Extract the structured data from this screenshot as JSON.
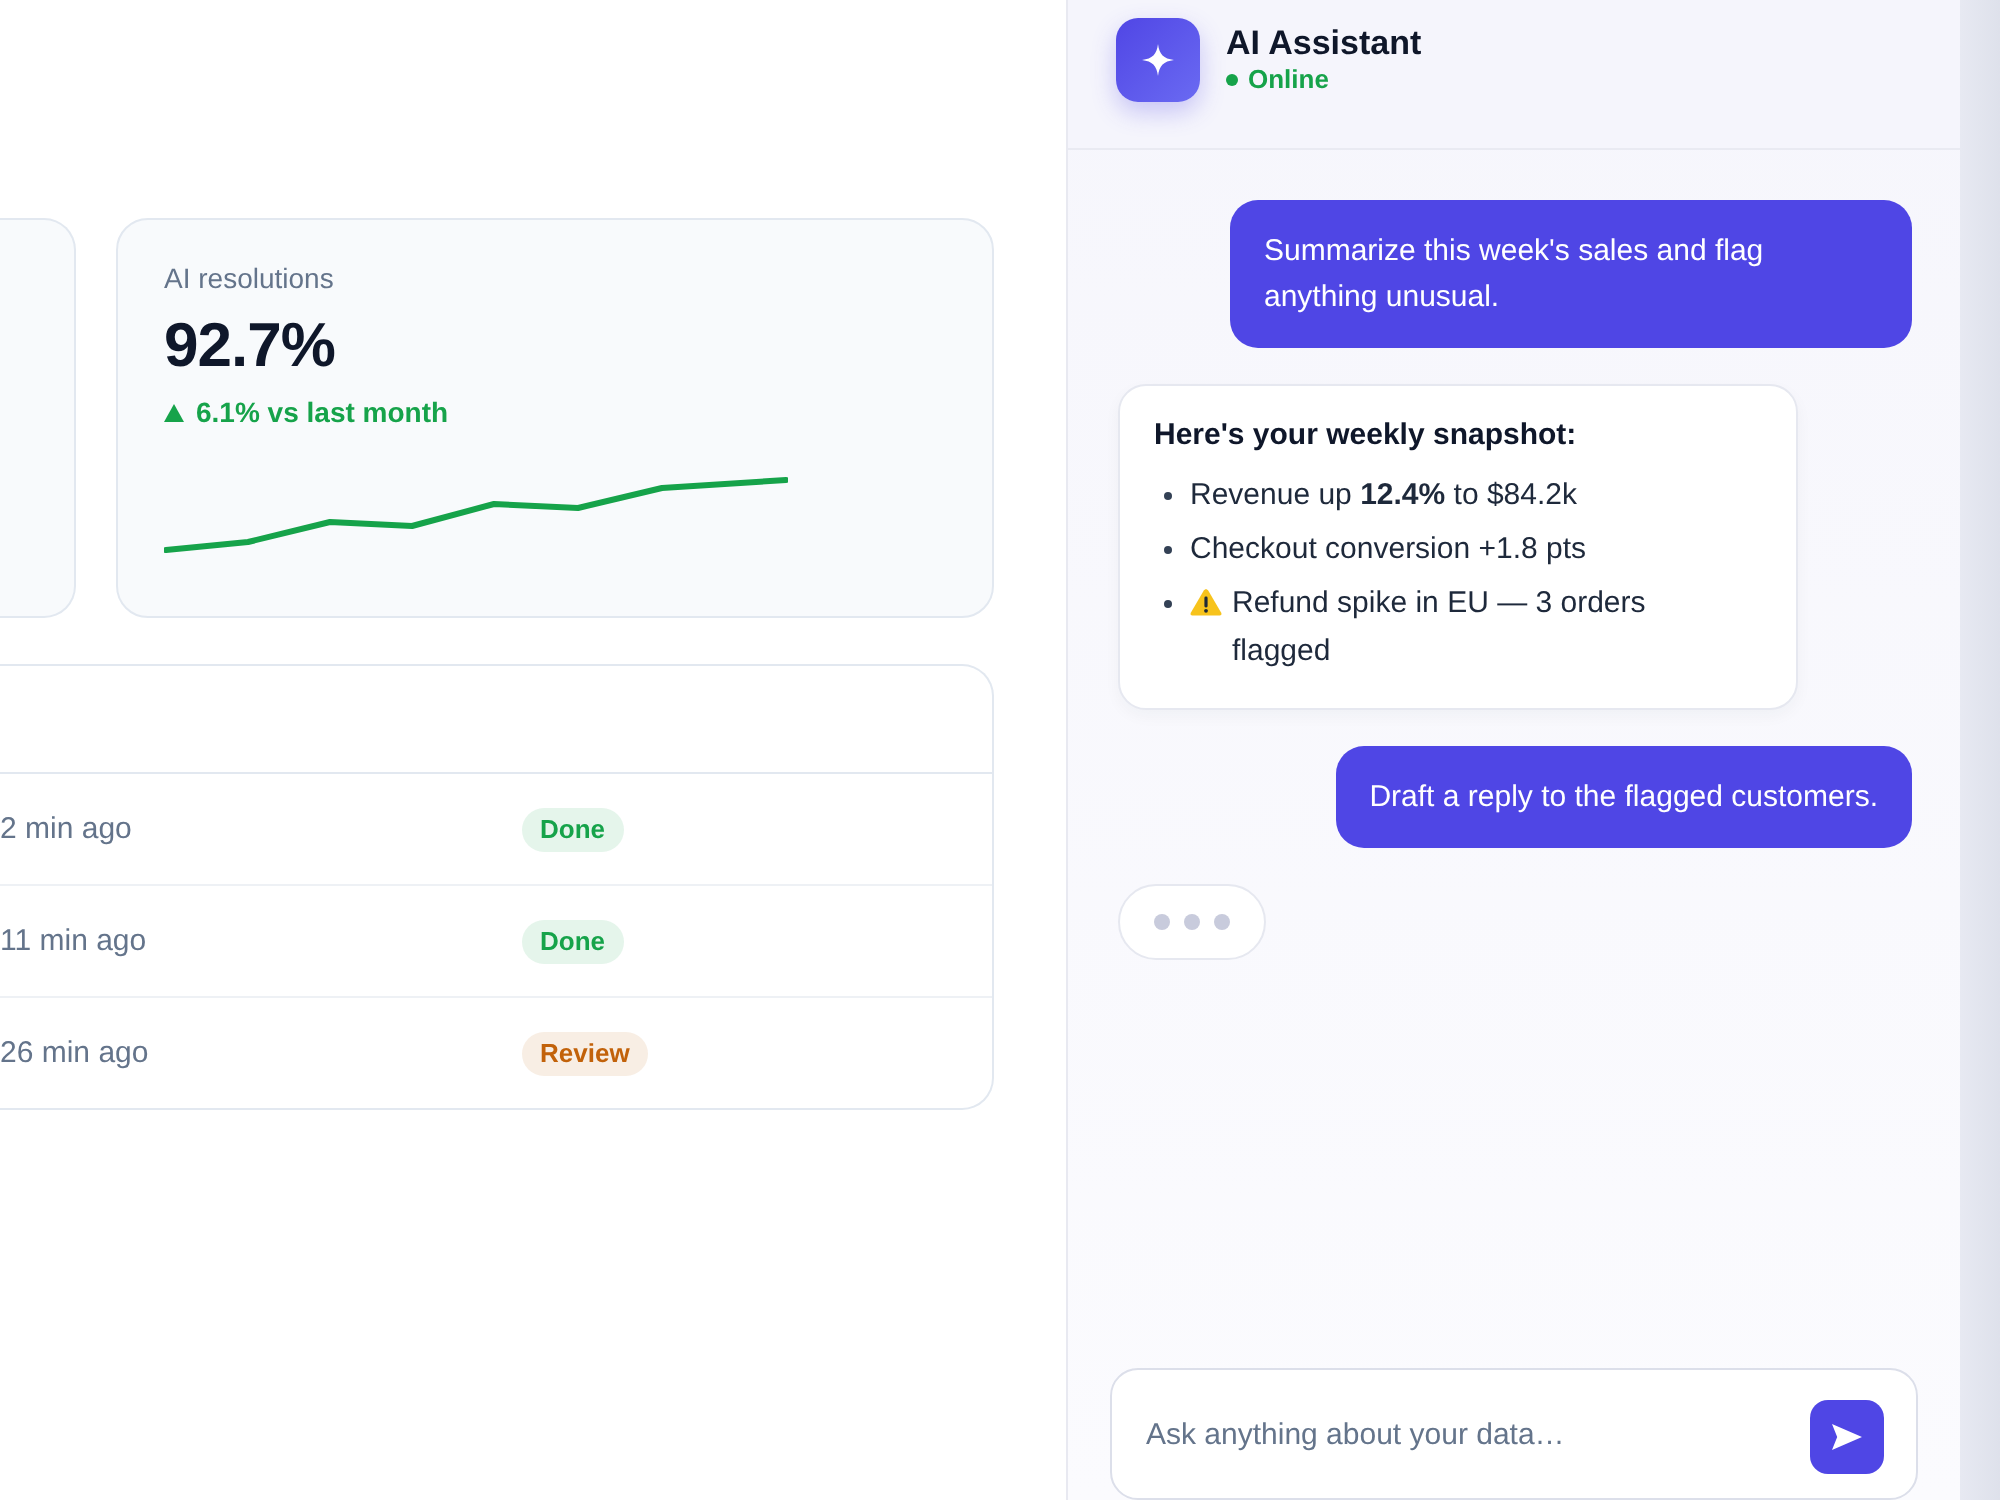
{
  "metric_card": {
    "label": "AI resolutions",
    "value": "92.7%",
    "change": {
      "kind": "up",
      "text": "6.1% vs last month"
    }
  },
  "table": {
    "rows": [
      {
        "column_1": "2 min ago",
        "column_2": {
          "label": "Done",
          "color": "#16a34a"
        }
      },
      {
        "column_1": "11 min ago",
        "column_2": {
          "label": "Done",
          "color": "#16a34a"
        }
      },
      {
        "column_1": "26 min ago",
        "column_2": {
          "label": "Review",
          "color": "#c2620a"
        }
      }
    ]
  },
  "chat": {
    "header": {
      "title": "AI Assistant",
      "status": "Online",
      "online": true
    },
    "messages": [
      {
        "kind": "user",
        "text": "Summarize this week's sales and flag anything unusual."
      },
      {
        "kind": "assistant",
        "title": "Here's your weekly snapshot:",
        "items": [
          {
            "kind": "plain",
            "text": "Revenue up **12.4%** to $84.2k"
          },
          {
            "kind": "plain",
            "text": "Checkout conversion +1.8 pts"
          },
          {
            "kind": "warning",
            "text": "Refund spike in EU — 3 orders flagged"
          }
        ]
      },
      {
        "kind": "user",
        "text": "Draft a reply to the flagged customers."
      }
    ],
    "typing": true,
    "input": {
      "placeholder": "Ask anything about your data…"
    }
  }
}
